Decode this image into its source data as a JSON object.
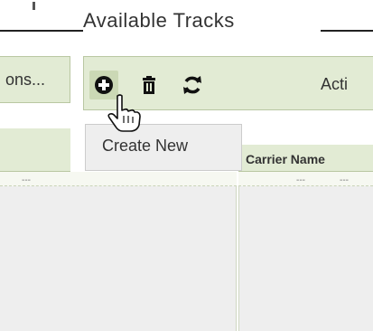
{
  "legend": {
    "title": "Available Tracks"
  },
  "left_toolbar": {
    "label": "ons..."
  },
  "main_toolbar": {
    "actions_label": "Acti",
    "buttons": [
      {
        "name": "add",
        "icon": "plus-circle-icon"
      },
      {
        "name": "delete",
        "icon": "trash-icon"
      },
      {
        "name": "refresh",
        "icon": "refresh-icon"
      }
    ]
  },
  "tooltip": {
    "text": "Create New"
  },
  "grid": {
    "right_column_header": "Carrier Name",
    "filter_placeholder": "---"
  },
  "colors": {
    "toolbar_bg": "#e2ebd4",
    "toolbar_border": "#b9c7a2",
    "grid_bg": "#eeeeee"
  }
}
